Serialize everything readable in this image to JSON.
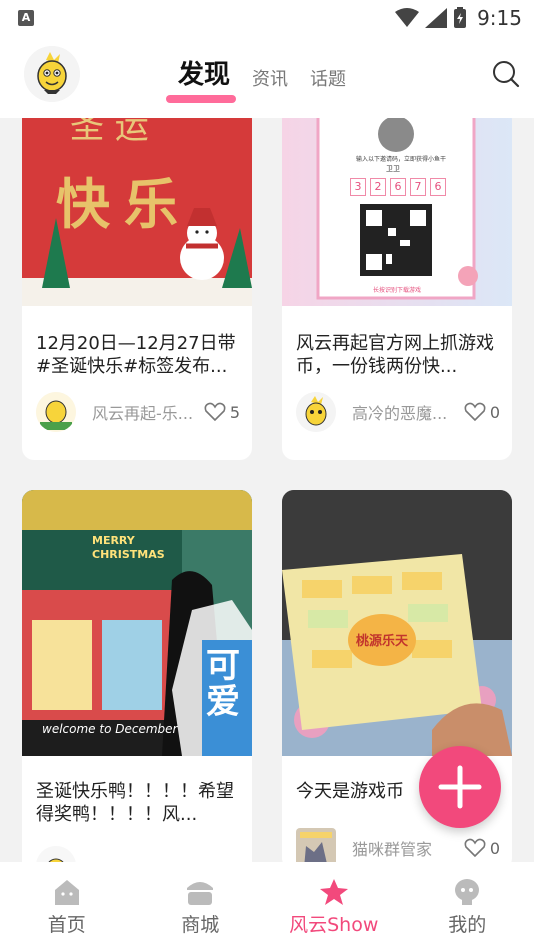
{
  "status_bar": {
    "time": "9:15"
  },
  "header": {
    "tabs": [
      {
        "label": "发现",
        "active": true
      },
      {
        "label": "资讯",
        "active": false
      },
      {
        "label": "话题",
        "active": false
      }
    ]
  },
  "feed": {
    "cards": [
      {
        "title": "12月20日—12月27日带#圣诞快乐#标签发布...",
        "author": "风云再起-乐...",
        "likes": "5"
      },
      {
        "title": "风云再起官方网上抓游戏币，一份钱两份快...",
        "author": "高冷的恶魔...",
        "likes": "0"
      },
      {
        "title": "圣诞快乐鸭！！！！希望得奖鸭！！！！风...",
        "author": "",
        "likes": ""
      },
      {
        "title": "今天是游戏币",
        "author": "猫咪群管家",
        "likes": "0"
      }
    ],
    "card1_image_text": "快乐",
    "card2_code": [
      "3",
      "2",
      "6",
      "7",
      "6"
    ],
    "card2_caption": "输入以下邀请码，立即获得小鱼干",
    "card2_name": "卫卫",
    "card2_button": "长按识别下载游戏",
    "card3_image_text": {
      "banner": "MERRY CHRISTMAS",
      "welcome": "welcome to December",
      "big": "可爱"
    },
    "card4_image_text": "桃源乐天"
  },
  "bottom_nav": [
    {
      "label": "首页",
      "icon": "home-icon",
      "active": false
    },
    {
      "label": "商城",
      "icon": "shop-icon",
      "active": false
    },
    {
      "label": "风云Show",
      "icon": "star-icon",
      "active": true
    },
    {
      "label": "我的",
      "icon": "profile-icon",
      "active": false
    }
  ],
  "colors": {
    "accent": "#f2497c",
    "underline": "#ff6b9a"
  }
}
